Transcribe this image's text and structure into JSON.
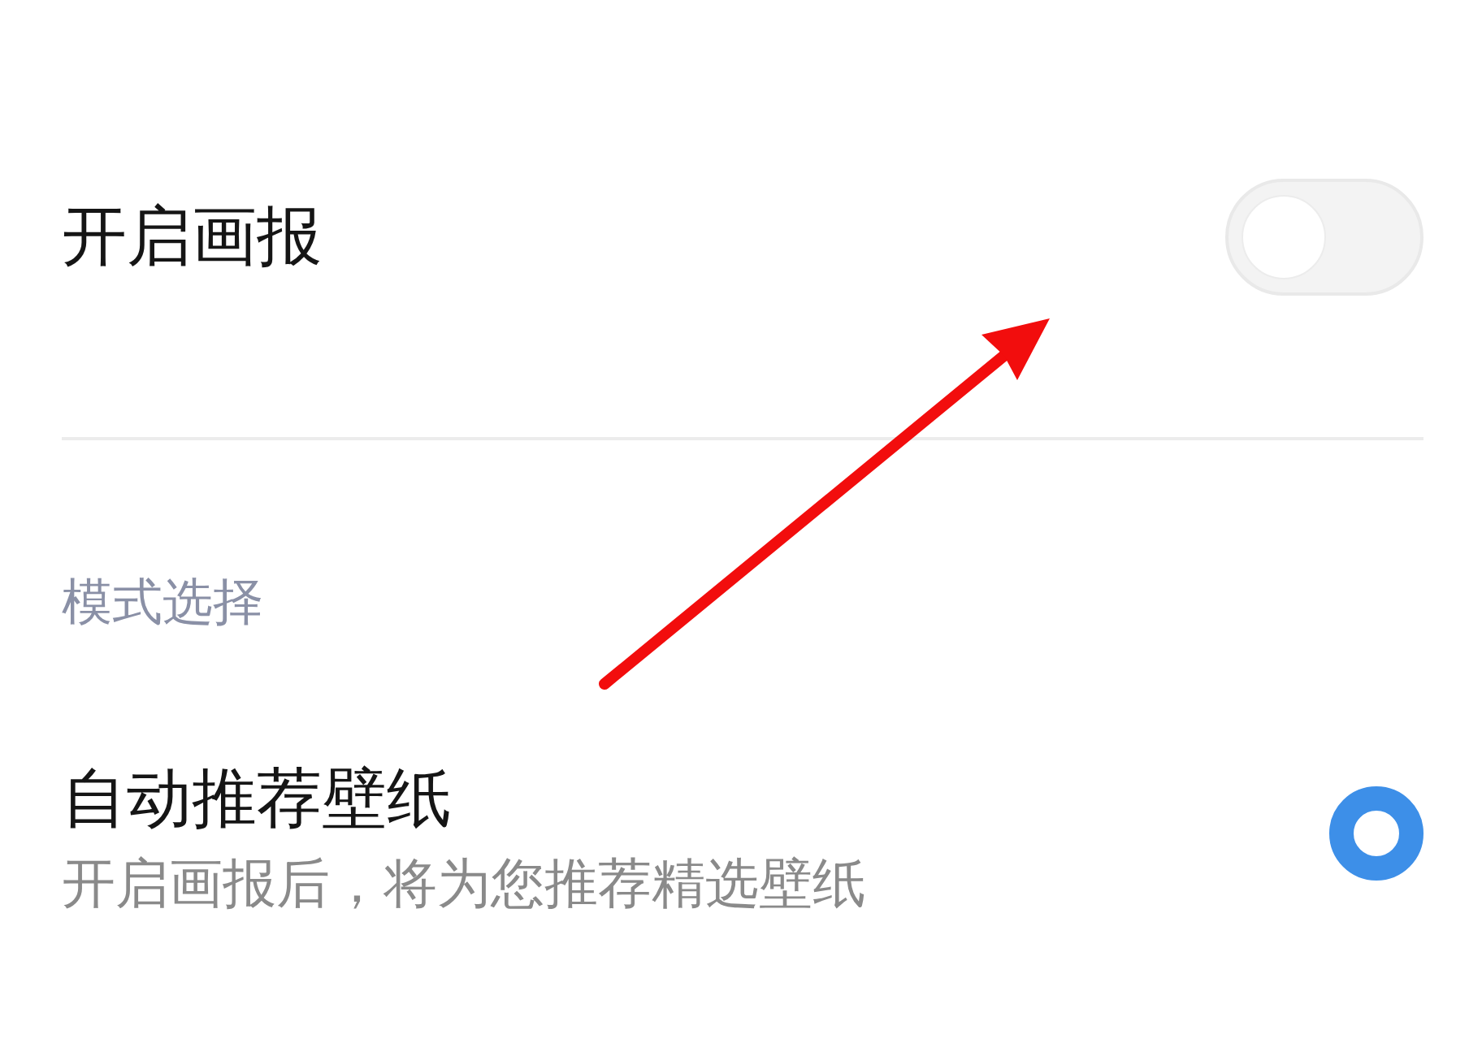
{
  "settings": [
    {
      "kind": "toggle",
      "label": "开启画报",
      "on": false
    }
  ],
  "section": {
    "title": "模式选择"
  },
  "options": [
    {
      "kind": "radio",
      "label": "自动推荐壁纸",
      "description": "开启画报后，将为您推荐精选壁纸",
      "selected": true
    }
  ]
}
